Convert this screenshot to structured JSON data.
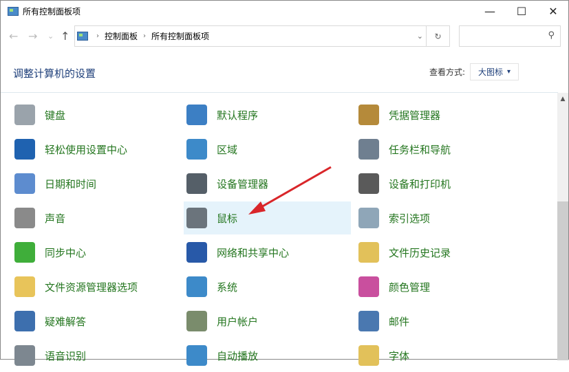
{
  "window": {
    "title": "所有控制面板项",
    "minimize": "—",
    "maximize": "☐",
    "close": "✕"
  },
  "nav": {
    "back": "←",
    "forward": "→",
    "recent": "⌄",
    "up": "↑"
  },
  "address": {
    "crumbs": [
      "控制面板",
      "所有控制面板项"
    ],
    "separator": "›",
    "dropdown": "⌄",
    "refresh": "↻"
  },
  "search": {
    "placeholder": "",
    "icon": "⚲"
  },
  "heading": "调整计算机的设置",
  "view": {
    "label": "查看方式:",
    "value": "大图标",
    "arrow": "▾"
  },
  "items": [
    {
      "label": "键盘",
      "color": "#9aa3ab"
    },
    {
      "label": "默认程序",
      "color": "#3c7fc4"
    },
    {
      "label": "凭据管理器",
      "color": "#b58a3a"
    },
    {
      "label": "轻松使用设置中心",
      "color": "#1f62b0"
    },
    {
      "label": "区域",
      "color": "#3d8ac9"
    },
    {
      "label": "任务栏和导航",
      "color": "#6f7f90"
    },
    {
      "label": "日期和时间",
      "color": "#5d8ccf"
    },
    {
      "label": "设备管理器",
      "color": "#555f68"
    },
    {
      "label": "设备和打印机",
      "color": "#5a5a5a"
    },
    {
      "label": "声音",
      "color": "#8a8a8a"
    },
    {
      "label": "鼠标",
      "color": "#6b747c"
    },
    {
      "label": "索引选项",
      "color": "#8fa6b8"
    },
    {
      "label": "同步中心",
      "color": "#3fae3a"
    },
    {
      "label": "网络和共享中心",
      "color": "#2859a8"
    },
    {
      "label": "文件历史记录",
      "color": "#e2c15a"
    },
    {
      "label": "文件资源管理器选项",
      "color": "#e8c45a"
    },
    {
      "label": "系统",
      "color": "#3d8ac9"
    },
    {
      "label": "颜色管理",
      "color": "#c94f9e"
    },
    {
      "label": "疑难解答",
      "color": "#3d6fae"
    },
    {
      "label": "用户帐户",
      "color": "#7a8c6c"
    },
    {
      "label": "邮件",
      "color": "#4a78b0"
    },
    {
      "label": "语音识别",
      "color": "#7d8790"
    },
    {
      "label": "自动播放",
      "color": "#3d8ac9"
    },
    {
      "label": "字体",
      "color": "#e2c15a"
    }
  ],
  "selected_item": "鼠标",
  "annotation_color": "#d9262a"
}
